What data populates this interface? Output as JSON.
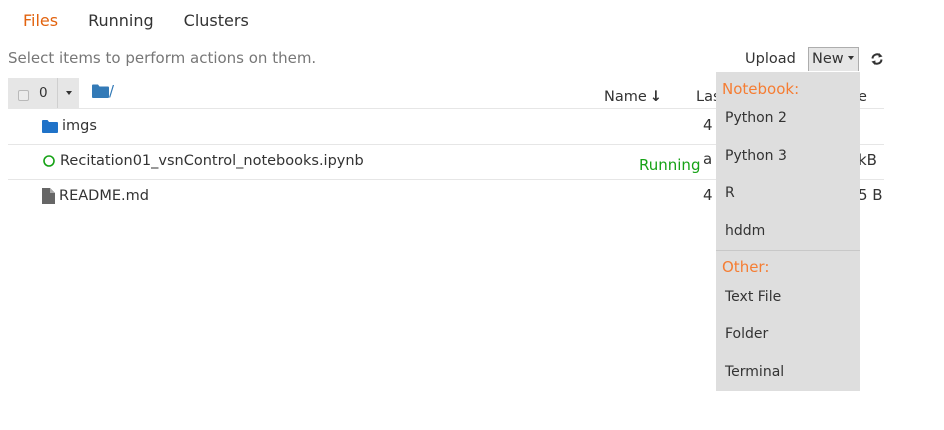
{
  "tabs": [
    {
      "label": "Files",
      "active": true
    },
    {
      "label": "Running",
      "active": false
    },
    {
      "label": "Clusters",
      "active": false
    }
  ],
  "toolbar": {
    "hint": "Select items to perform actions on them.",
    "upload_label": "Upload",
    "new_label": "New",
    "refresh_icon": "refresh-icon"
  },
  "selection": {
    "count": "0"
  },
  "breadcrumb": {
    "root_label": "/"
  },
  "columns": {
    "name": "Name",
    "name_sort_glyph": "↓",
    "last_modified_partial": "Las",
    "file_size_partial": "e"
  },
  "files": [
    {
      "name": "imgs",
      "icon": "folder-icon",
      "date_partial": "4",
      "size_partial": "",
      "running": ""
    },
    {
      "name": "Recitation01_vsnControl_notebooks.ipynb",
      "icon": "notebook-running-icon",
      "date_partial": "a",
      "size_partial": "kB",
      "running": "Running"
    },
    {
      "name": "README.md",
      "icon": "file-icon",
      "date_partial": "4",
      "size_partial": "5 B",
      "running": ""
    }
  ],
  "new_menu": {
    "notebook_header": "Notebook:",
    "notebook_items": [
      "Python 2",
      "Python 3",
      "R",
      "hddm"
    ],
    "other_header": "Other:",
    "other_items": [
      "Text File",
      "Folder",
      "Terminal"
    ]
  },
  "colors": {
    "accent_orange": "#e2630f",
    "menu_header_orange": "#f57d33",
    "running_green": "#16a216",
    "folder_blue": "#337ab7"
  }
}
